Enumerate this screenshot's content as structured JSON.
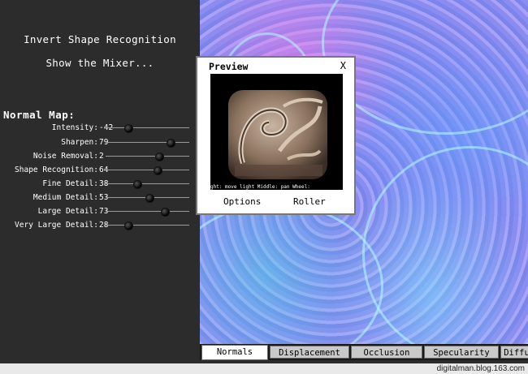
{
  "menu": {
    "invert_shape_recognition": "Invert Shape Recognition",
    "show_mixer": "Show the Mixer..."
  },
  "section_title": "Normal Map:",
  "sliders": [
    {
      "label": "Intensity:",
      "value": "-42",
      "level": 0.27
    },
    {
      "label": "Sharpen:",
      "value": "79",
      "level": 0.78
    },
    {
      "label": "Noise Removal:",
      "value": "2",
      "level": 0.64
    },
    {
      "label": "Shape Recognition:",
      "value": "64",
      "level": 0.62
    },
    {
      "label": "Fine Detail:",
      "value": "38",
      "level": 0.38
    },
    {
      "label": "Medium Detail:",
      "value": "53",
      "level": 0.52
    },
    {
      "label": "Large Detail:",
      "value": "73",
      "level": 0.71
    },
    {
      "label": "Very Large Detail:",
      "value": "28",
      "level": 0.27
    }
  ],
  "preview": {
    "title": "Preview",
    "close": "X",
    "hint": "ght: move light   Middle: pan    Wheel:",
    "options": "Options",
    "roller": "Roller"
  },
  "tabs": [
    "Normals",
    "Displacement",
    "Occlusion",
    "Specularity",
    "Diffu"
  ],
  "active_tab": 0,
  "watermark": "digitalman.blog.163.com",
  "colors": {
    "panel": "#2c2c2c",
    "normal_map_base": "#8c8ff2",
    "tab": "#c9c9c9"
  }
}
